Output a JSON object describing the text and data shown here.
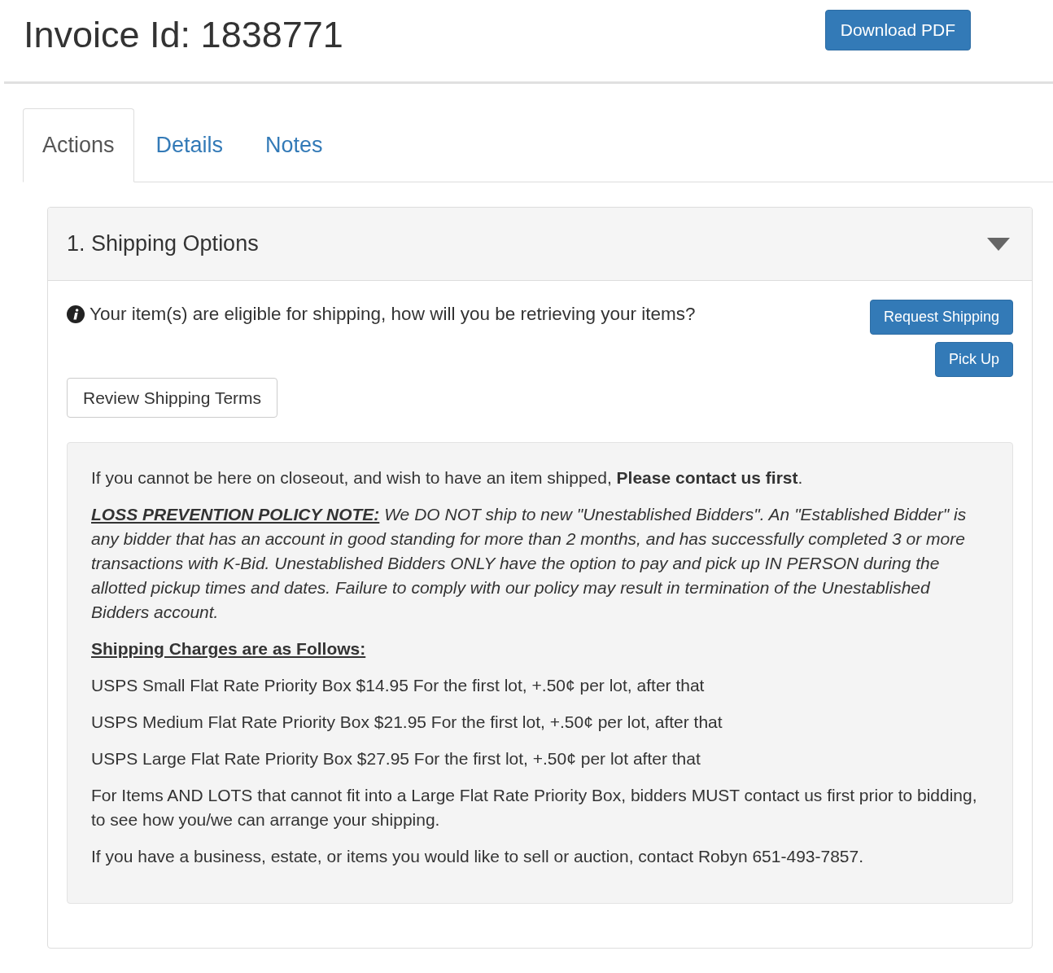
{
  "header": {
    "title": "Invoice Id: 1838771",
    "download_button": "Download PDF"
  },
  "tabs": [
    {
      "label": "Actions",
      "selected": true
    },
    {
      "label": "Details",
      "selected": false
    },
    {
      "label": "Notes",
      "selected": false
    }
  ],
  "panel": {
    "title": "1. Shipping Options",
    "expanded": true,
    "prompt": "Your item(s) are eligible for shipping, how will you be retrieving your items?",
    "actions": [
      {
        "label": "Request Shipping"
      },
      {
        "label": "Pick Up"
      }
    ],
    "terms_button": "Review Shipping Terms",
    "notice": [
      {
        "kind": "text",
        "text": "If you cannot be here on closeout, and wish to have an item shipped, **Please contact us first**."
      },
      {
        "kind": "policy",
        "label": "LOSS PREVENTION POLICY NOTE:",
        "text": "We DO NOT ship to new \"Unestablished Bidders\". An \"Established Bidder\" is any bidder that has an account in good standing for more than 2 months, and has successfully completed 3 or more transactions with K-Bid. Unestablished Bidders ONLY have the option to pay and pick up IN PERSON during the allotted pickup times and dates. Failure to comply with our policy may result in termination of the Unestablished Bidders account."
      },
      {
        "kind": "heading",
        "text": "Shipping Charges are as Follows:"
      },
      {
        "kind": "text",
        "text": "USPS Small Flat Rate Priority Box $14.95 For the first lot, +.50¢ per lot, after that"
      },
      {
        "kind": "text",
        "text": "USPS Medium Flat Rate Priority Box $21.95 For the first lot, +.50¢ per lot, after that"
      },
      {
        "kind": "text",
        "text": "USPS Large Flat Rate Priority Box $27.95 For the first lot, +.50¢ per lot after that"
      },
      {
        "kind": "text",
        "text": "For Items AND LOTS that cannot fit into a Large Flat Rate Priority Box, bidders MUST contact us first prior to bidding, to see how you/we can arrange your shipping."
      },
      {
        "kind": "text",
        "text": "If you have a business, estate, or items you would like to sell or auction, contact Robyn 651-493-7857."
      }
    ]
  }
}
